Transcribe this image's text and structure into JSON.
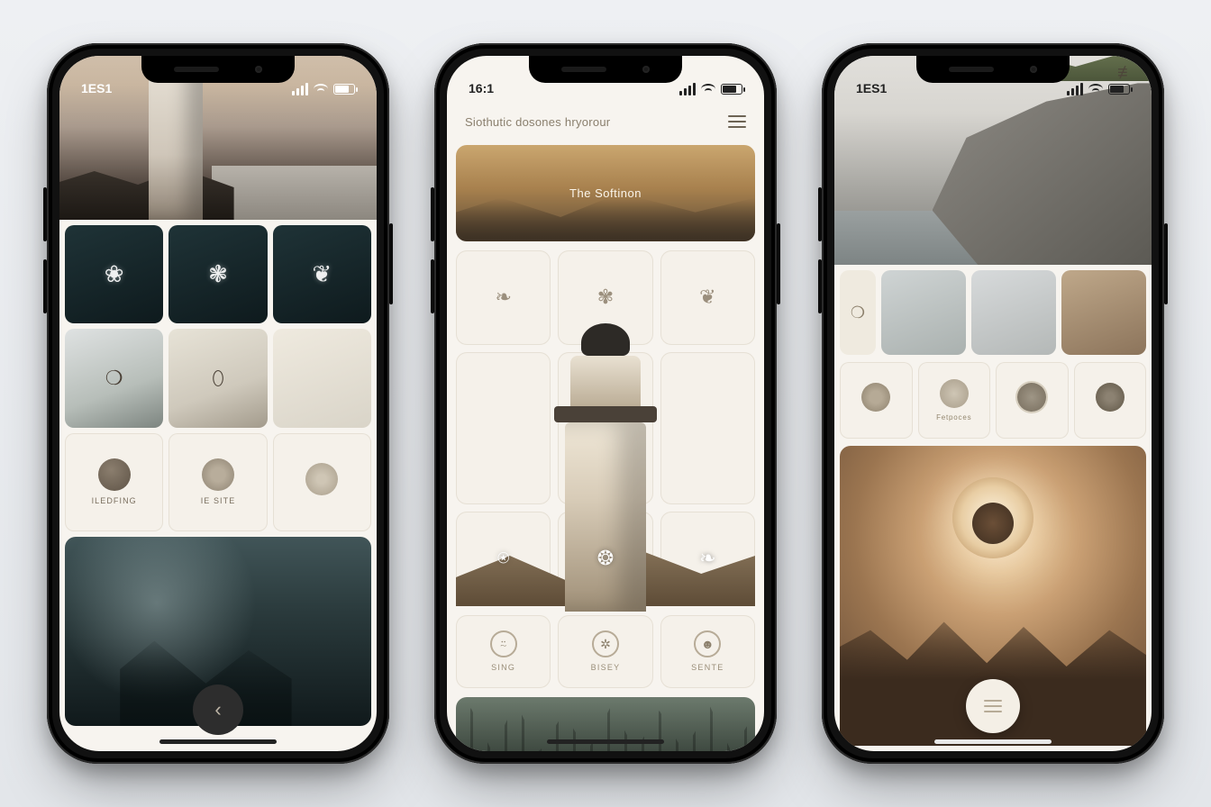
{
  "phone1": {
    "status_time": "1ES1",
    "row3": [
      "ILEDFING",
      "IE SITE",
      ""
    ],
    "fab_glyph": "‹"
  },
  "phone2": {
    "status_time": "16:1",
    "appbar_title": "Siothutic dosones hryorour",
    "banner_label": "The Softinon",
    "nav": [
      "SING",
      "BISEY",
      "SENTE"
    ]
  },
  "phone3": {
    "status_time": "1ES1",
    "cats": [
      "",
      "Fetpoces",
      "",
      ""
    ]
  }
}
